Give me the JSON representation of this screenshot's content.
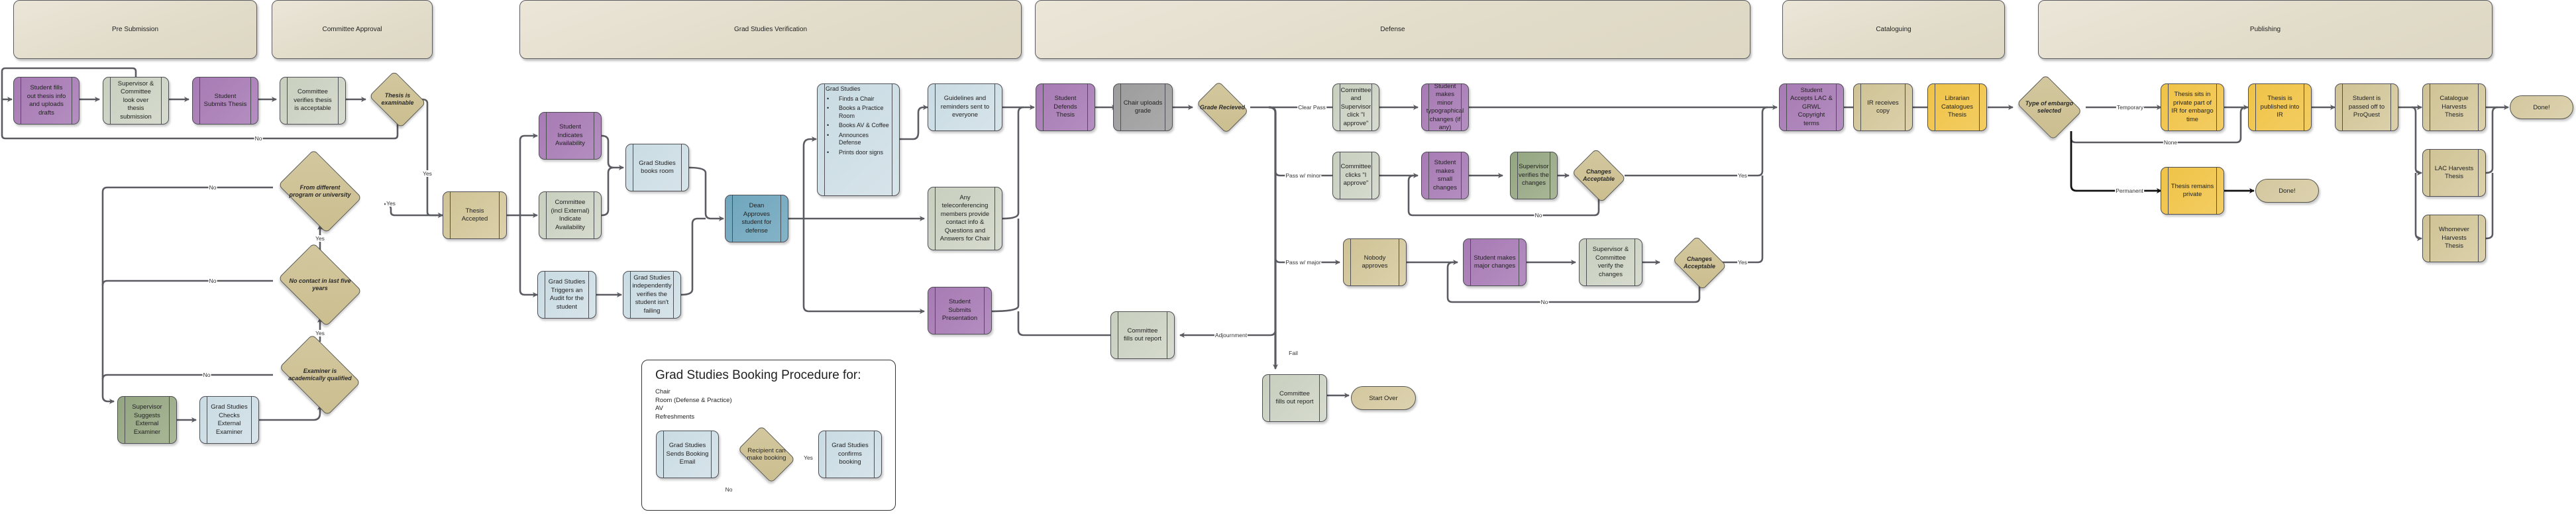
{
  "lanes": [
    {
      "id": "pre-submission",
      "label": "Pre Submission"
    },
    {
      "id": "committee-approval",
      "label": "Committee Approval"
    },
    {
      "id": "grad-studies-verification",
      "label": "Grad Studies Verification"
    },
    {
      "id": "defense",
      "label": "Defense"
    },
    {
      "id": "cataloguing",
      "label": "Cataloguing"
    },
    {
      "id": "publishing",
      "label": "Publishing"
    }
  ],
  "nodes": {
    "student_fills": {
      "label": "Student fills\nout thesis info\nand uploads\ndrafts",
      "color": "purple"
    },
    "supervisor_look": {
      "label": "Supervisor &\nCommittee\nlook over\nthesis\nsubmission",
      "color": "sage"
    },
    "student_submits": {
      "label": "Student\nSubmits Thesis",
      "color": "purple"
    },
    "committee_verifies": {
      "label": "Committee\nverifies thesis\nis acceptable",
      "color": "sage"
    },
    "thesis_accepted": {
      "label": "Thesis\nAccepted",
      "color": "tan"
    },
    "supervisor_suggests": {
      "label": "Supervisor\nSuggests\nExternal\nExaminer",
      "color": "darkgreen"
    },
    "gs_checks": {
      "label": "Grad Studies\nChecks\nExternal\nExaminer",
      "color": "lightblue"
    },
    "student_availability": {
      "label": "Student\nIndicates\nAvailability",
      "color": "purple"
    },
    "committee_availability": {
      "label": "Committee\n(incl External)\nIndicate\nAvailability",
      "color": "sage"
    },
    "gs_books_room": {
      "label": "Grad Studies\nbooks room",
      "color": "lightblue"
    },
    "gs_audit": {
      "label": "Grad Studies\nTriggers an\nAudit for the\nstudent",
      "color": "lightblue"
    },
    "gs_verifies": {
      "label": "Grad Studies\nindependently\nverifies the\nstudent isn't\nfailing",
      "color": "lightblue"
    },
    "dean_approves": {
      "label": "Dean\nApproves\nstudent for\ndefense",
      "color": "teal"
    },
    "gs_tasks": {
      "title": "Grad Studies",
      "items": [
        "Finds a Chair",
        "Books a Practice Room",
        "Books AV & Coffee",
        "Announces Defense",
        "Prints door signs"
      ],
      "color": "lightblue"
    },
    "guidelines": {
      "label": "Guidelines and\nreminders sent to\neveryone",
      "color": "lightblue"
    },
    "teleconf": {
      "label": "Any\nteleconferencing\nmembers provide\ncontact info &\nQuestions and\nAnswers for Chair",
      "color": "sage"
    },
    "student_presentation": {
      "label": "Student\nSubmits\nPresentation",
      "color": "purple"
    },
    "student_defends": {
      "label": "Student\nDefends\nThesis",
      "color": "purple"
    },
    "chair_uploads": {
      "label": "Chair uploads\ngrade",
      "color": "gray"
    },
    "committee_report_adj": {
      "label": "Committee\nfills out report",
      "color": "sage"
    },
    "committee_report_fail": {
      "label": "Committee\nfills out report",
      "color": "sage"
    },
    "committee_supervisor_approve": {
      "label": "Committee\nand Supervisor\nclick \"I\napprove\"",
      "color": "sage"
    },
    "committee_clicks_approve": {
      "label": "Committee\nclicks \"I\napprove\"",
      "color": "sage"
    },
    "nobody_approves": {
      "label": "Nobody\napproves",
      "color": "tan"
    },
    "student_minor_typo": {
      "label": "Student makes\nminor\ntypographical\nchanges (if\nany)",
      "color": "purple"
    },
    "student_small_changes": {
      "label": "Student makes\nsmall changes",
      "color": "purple"
    },
    "student_major_changes": {
      "label": "Student makes\nmajor changes",
      "color": "purple"
    },
    "supervisor_verifies_changes": {
      "label": "Supervisor\nverifies the\nchanges",
      "color": "darkgreen"
    },
    "sup_committee_verify": {
      "label": "Supervisor &\nCommittee\nverify the\nchanges",
      "color": "sage"
    },
    "student_accepts_lac": {
      "label": "Student\nAccepts LAC &\nGRWL\nCopyright\nterms",
      "color": "purple"
    },
    "ir_receives": {
      "label": "IR receives\ncopy",
      "color": "tan"
    },
    "librarian_catalogues": {
      "label": "Librarian\nCatalogues\nThesis",
      "color": "yellow"
    },
    "thesis_sits_private": {
      "label": "Thesis sits in\nprivate part of\nIR for embargo\ntime",
      "color": "yellow"
    },
    "thesis_published_ir": {
      "label": "Thesis is\npublished into\nIR",
      "color": "yellow"
    },
    "thesis_remains_private": {
      "label": "Thesis remains\nprivate",
      "color": "yellow"
    },
    "passed_proquest": {
      "label": "Student is\npassed off to\nProQuest",
      "color": "tan"
    },
    "catalogue_harvests": {
      "label": "Catalogue\nHarvests\nThesis",
      "color": "tan"
    },
    "lac_harvests": {
      "label": "LAC Harvests\nThesis",
      "color": "tan"
    },
    "whomever_harvests": {
      "label": "Whomever\nHarvests\nThesis",
      "color": "tan"
    },
    "legend_sends_email": {
      "label": "Grad Studies\nSends Booking\nEmail",
      "color": "lightblue"
    },
    "legend_confirms": {
      "label": "Grad Studies\nconfirms\nbooking",
      "color": "lightblue"
    }
  },
  "decisions": {
    "thesis_examinable": "Thesis is\nexaminable",
    "different_program": "From different\nprogram or university",
    "no_contact": "No contact in last five\nyears",
    "examiner_qualified": "Examiner is\nacademically qualified",
    "grade_received": "Grade Recieved",
    "changes_acceptable_minor": "Changes\nAcceptable",
    "changes_acceptable_major": "Changes\nAcceptable",
    "embargo_type": "Type of embargo\nselected",
    "legend_recipient": "Recipient can\nmake booking"
  },
  "terminals": {
    "start_over": "Start Over",
    "done_private": "Done!",
    "done_final": "Done!"
  },
  "edge_labels": {
    "no": "No",
    "yes": "Yes",
    "clear_pass": "Clear Pass",
    "pass_minor": "Pass w/ minor",
    "pass_major": "Pass w/ major",
    "adjournment": "Adjournment",
    "fail": "Fail",
    "temporary": "Temporary",
    "none": "None",
    "permanent": "Permanent"
  },
  "legend": {
    "title": "Grad Studies Booking Procedure for:",
    "items": [
      "Chair",
      "Room (Defense & Practice)",
      "AV",
      "Refreshments"
    ]
  },
  "colors": {
    "purple": "#ad84b9",
    "sage": "#cfd5c6",
    "lightblue": "#d0e0e7",
    "tan": "#d4c8a0",
    "darkgreen": "#9dae8b",
    "gray": "#a4a4a4",
    "teal": "#79acc2",
    "yellow": "#f1c855",
    "edge": "#5b5b62"
  }
}
